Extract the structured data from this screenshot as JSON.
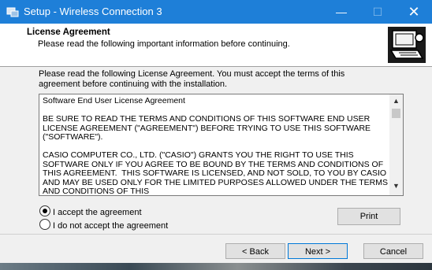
{
  "window": {
    "title": "Setup - Wireless Connection 3",
    "controls": {
      "minimize": "—",
      "maximize": "☐",
      "close": "✕"
    }
  },
  "header": {
    "title": "License Agreement",
    "subtitle": "Please read the following important information before continuing.",
    "icon": "setup-computer-icon"
  },
  "body": {
    "intro": "Please read the following License Agreement. You must accept the terms of this agreement before continuing with the installation.",
    "license_text": "Software End User License Agreement\n\nBE SURE TO READ THE TERMS AND CONDITIONS OF THIS SOFTWARE END USER LICENSE AGREEMENT (\"AGREEMENT\") BEFORE TRYING TO USE THIS SOFTWARE (\"SOFTWARE\").\n\nCASIO COMPUTER CO., LTD. (\"CASIO\") GRANTS YOU THE RIGHT TO USE THIS SOFTWARE ONLY IF YOU AGREE TO BE BOUND BY THE TERMS AND CONDITIONS OF THIS AGREEMENT.  THIS SOFTWARE IS LICENSED, AND NOT SOLD, TO YOU BY CASIO AND MAY BE USED ONLY FOR THE LIMITED PURPOSES ALLOWED UNDER THE TERMS AND CONDITIONS OF THIS",
    "radio_accept": "I accept the agreement",
    "radio_decline": "I do not accept the agreement",
    "selected": "accept",
    "print_label": "Print"
  },
  "footer": {
    "back_label": "< Back",
    "next_label": "Next >",
    "cancel_label": "Cancel"
  },
  "colors": {
    "titlebar": "#1e7fd8",
    "focus_border": "#0078d7"
  }
}
